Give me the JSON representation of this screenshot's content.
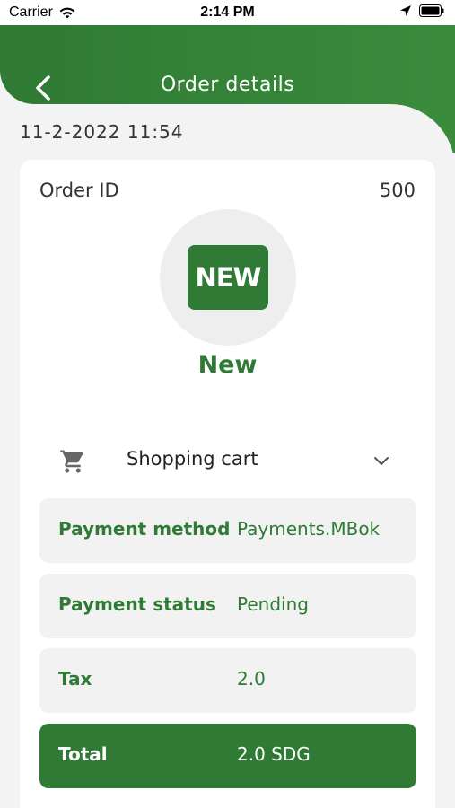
{
  "status_bar": {
    "carrier": "Carrier",
    "time": "2:14 PM"
  },
  "header": {
    "title": "Order details"
  },
  "order": {
    "date": "11-2-2022 11:54",
    "id_label": "Order ID",
    "id_value": "500",
    "badge_text": "NEW",
    "status": "New"
  },
  "cart": {
    "label": "Shopping cart"
  },
  "details": {
    "payment_method_label": "Payment method",
    "payment_method_value": "Payments.MBok",
    "payment_status_label": "Payment status",
    "payment_status_value": "Pending",
    "tax_label": "Tax",
    "tax_value": "2.0",
    "total_label": "Total",
    "total_value": "2.0 SDG"
  },
  "colors": {
    "primary": "#2f7a34",
    "background": "#f3f3f3",
    "card": "#ffffff",
    "row": "#f2f2f2"
  },
  "icons": {
    "back": "chevron-left-icon",
    "cart": "shopping-cart-icon",
    "expand": "chevron-down-icon",
    "wifi": "wifi-icon",
    "location": "location-arrow-icon",
    "battery": "battery-icon"
  }
}
